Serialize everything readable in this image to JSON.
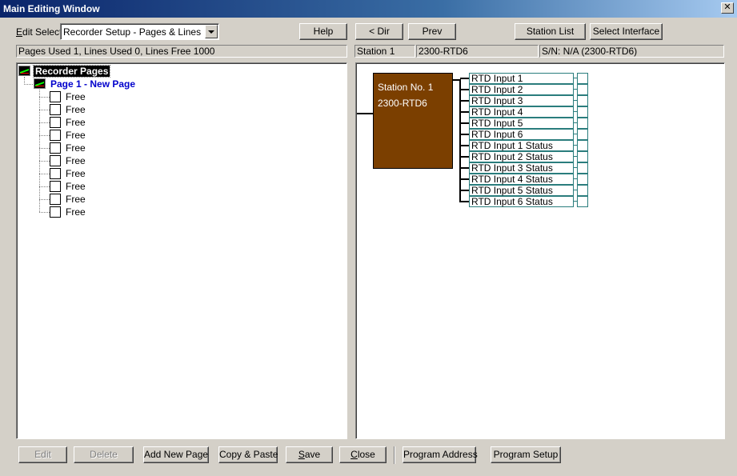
{
  "window": {
    "title": "Main Editing Window",
    "close_glyph": "✕"
  },
  "edit_select": {
    "label_prefix": "E",
    "label_rest": "dit Select",
    "value": "Recorder Setup - Pages & Lines"
  },
  "top_buttons": {
    "help": "Help",
    "dir": "< Dir",
    "prev": "Prev",
    "station_list": "Station List",
    "select_interface": "Select Interface"
  },
  "status": {
    "usage": "Pages Used 1, Lines Used 0, Lines Free 1000",
    "station": "Station 1",
    "model": "2300-RTD6",
    "serial": "S/N: N/A (2300-RTD6)"
  },
  "tree": {
    "root_label": "Recorder Pages",
    "page_label": "Page 1 - New Page",
    "free_lines": [
      "Free",
      "Free",
      "Free",
      "Free",
      "Free",
      "Free",
      "Free",
      "Free",
      "Free",
      "Free"
    ]
  },
  "diagram": {
    "station_name": "Station No. 1",
    "station_model": "2300-RTD6",
    "inputs": [
      "RTD Input 1",
      "RTD Input 2",
      "RTD Input 3",
      "RTD Input 4",
      "RTD Input 5",
      "RTD Input 6",
      "RTD Input 1 Status",
      "RTD Input 2 Status",
      "RTD Input 3 Status",
      "RTD Input 4 Status",
      "RTD Input 5 Status",
      "RTD Input 6 Status"
    ],
    "station_color": "#7b3f00",
    "item_border_color": "#2a7d7d"
  },
  "bottom_buttons": {
    "edit": "Edit",
    "delete": "Delete",
    "add_new_page": "Add New Page",
    "copy_paste": "Copy & Paste",
    "save_prefix": "S",
    "save_rest": "ave",
    "close_prefix": "C",
    "close_rest": "lose",
    "program_address": "Program Address",
    "program_setup": "Program Setup"
  }
}
